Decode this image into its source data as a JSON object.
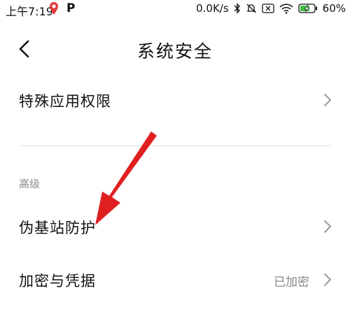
{
  "status_bar": {
    "time": "上午7:19",
    "net_speed": "0.0K/s",
    "battery": "60%",
    "icons": [
      "location-pin-icon",
      "p-app-icon",
      "bluetooth-icon",
      "mute-icon",
      "sim-x-icon",
      "wifi-icon",
      "battery-charging-icon"
    ]
  },
  "header": {
    "title": "系统安全",
    "back_icon": "chevron-left-icon"
  },
  "items": [
    {
      "label": "特殊应用权限",
      "value": ""
    },
    {
      "label": "伪基站防护",
      "value": ""
    },
    {
      "label": "加密与凭据",
      "value": "已加密"
    }
  ],
  "section_advanced": "高级",
  "colors": {
    "annotation_arrow": "#e02020",
    "battery_fill": "#3cc03c"
  }
}
